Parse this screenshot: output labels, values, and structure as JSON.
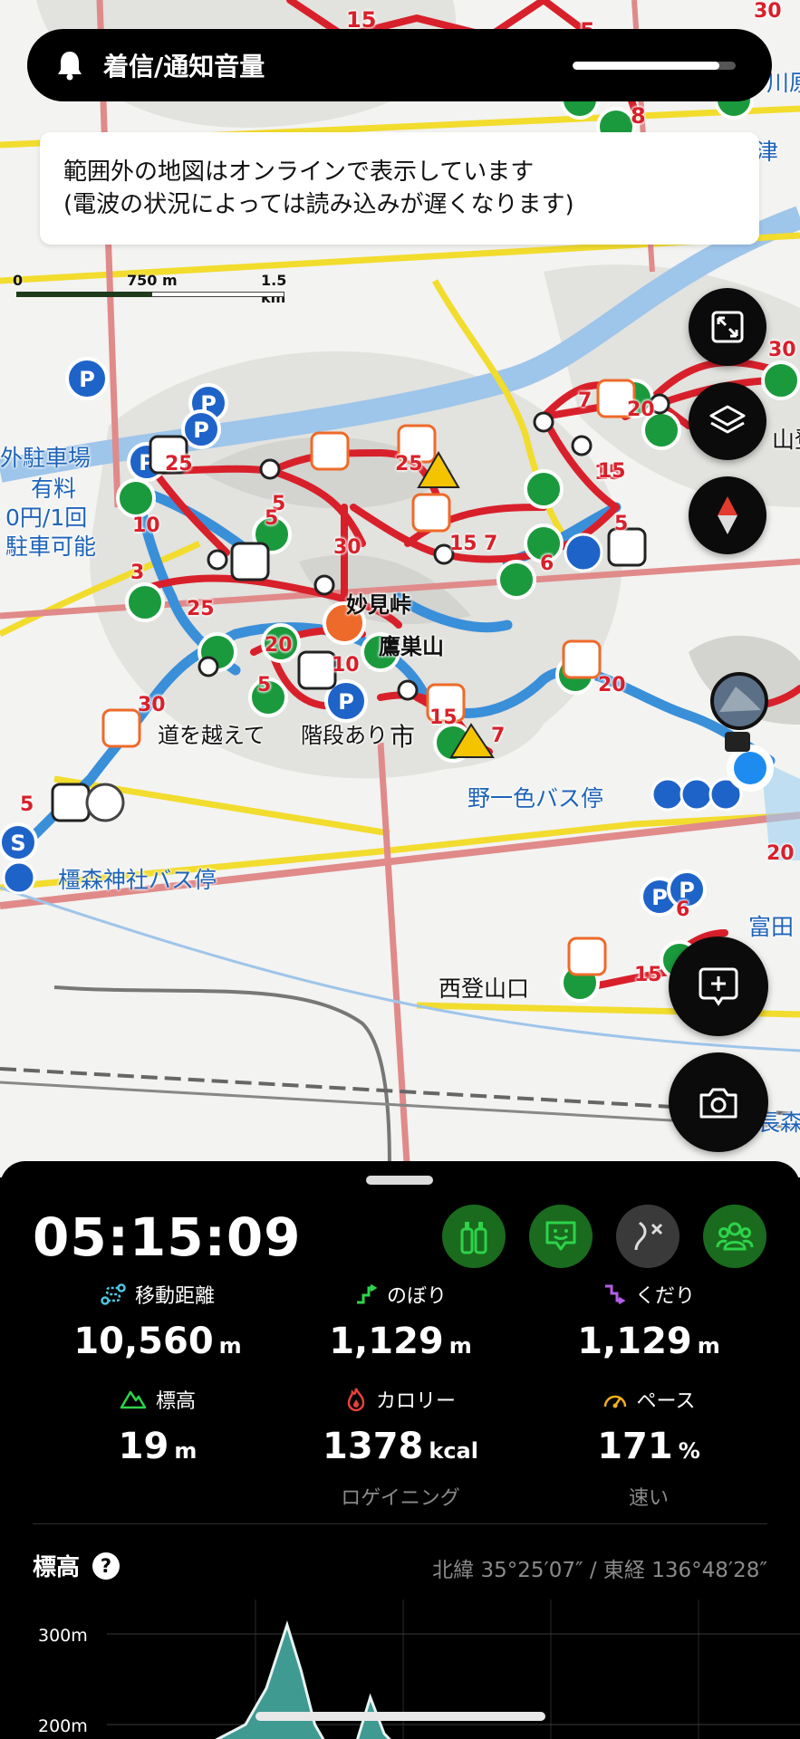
{
  "status": {
    "volume_label": "着信/通知音量",
    "volume_level": 0.9
  },
  "banner": {
    "line1": "範囲外の地図はオンラインで表示しています",
    "line2": "(電波の状況によっては読み込みが遅くなります)"
  },
  "scale": {
    "tick0": "0",
    "tick1": "750 m",
    "tick2": "1.5 km"
  },
  "map": {
    "labels": {
      "parking_side_1": "外駐車場",
      "parking_side_2": "有料",
      "parking_side_3": "0円/1回",
      "parking_side_4": "駐車可能",
      "myoken_pass": "妙見峠",
      "takasu_mountain": "鷹巣山",
      "road_cross": "道を越えて",
      "stairs": "階段あり",
      "city": "市",
      "noichi_bus": "野一色バス停",
      "kashimori_bus": "橿森神社バス停",
      "nishi_trailhead": "西登山口",
      "tomita": "富田",
      "nagamori": "長森",
      "kawahara": "川原",
      "yamato": "山登",
      "tsu": "津"
    },
    "markers": {
      "m1": "15",
      "m2": "5",
      "m3": "5",
      "m4": "8",
      "m5": "25",
      "m6": "25",
      "m7": "10",
      "m8": "3",
      "m9": "25",
      "m10": "5",
      "m11": "20",
      "m12": "5",
      "m13": "30",
      "m14": "30",
      "m15": "15",
      "m16": "7",
      "m17": "5",
      "m18": "6",
      "m19": "15",
      "m20": "20",
      "m21": "7",
      "m22": "15",
      "m23": "30",
      "m24": "10",
      "m25": "15",
      "m26": "7",
      "m27": "20",
      "m28": "5",
      "m29": "20",
      "m30": "6",
      "m31": "15",
      "m32": "5",
      "m33": "30"
    }
  },
  "panel": {
    "elapsed": "05:15:09",
    "stats": {
      "distance": {
        "label": "移動距離",
        "value": "10,560",
        "unit": "m"
      },
      "ascent": {
        "label": "のぼり",
        "value": "1,129",
        "unit": "m"
      },
      "descent": {
        "label": "くだり",
        "value": "1,129",
        "unit": "m"
      },
      "altitude": {
        "label": "標高",
        "value": "19",
        "unit": "m"
      },
      "calorie": {
        "label": "カロリー",
        "value": "1378",
        "unit": "kcal",
        "sub": "ロゲイニング"
      },
      "pace": {
        "label": "ペース",
        "value": "171",
        "unit": "%",
        "sub": "速い"
      }
    },
    "elevation": {
      "title": "標高",
      "help": "?",
      "coords": "北緯 35°25′07″ / 東経 136°48′28″"
    }
  },
  "chart_data": {
    "type": "area",
    "title": "標高",
    "ylabel": "",
    "yticks": [
      "300m",
      "200m"
    ],
    "ylim": [
      190,
      330
    ],
    "x": [
      0.0,
      0.05,
      0.1,
      0.15,
      0.2,
      0.23,
      0.26,
      0.28,
      0.3,
      0.33,
      0.36,
      0.38,
      0.4,
      0.45,
      0.5,
      0.55,
      0.6
    ],
    "values": [
      120,
      140,
      160,
      180,
      200,
      240,
      310,
      260,
      200,
      160,
      180,
      230,
      190,
      150,
      140,
      130,
      120
    ]
  },
  "colors": {
    "route_red": "#d8202b",
    "track_blue": "#3a8fd9",
    "road_yellow": "#f2dc2d",
    "poi_green": "#1a9a3c",
    "accent_green": "#2ed34a",
    "panel_bg": "#000000"
  }
}
